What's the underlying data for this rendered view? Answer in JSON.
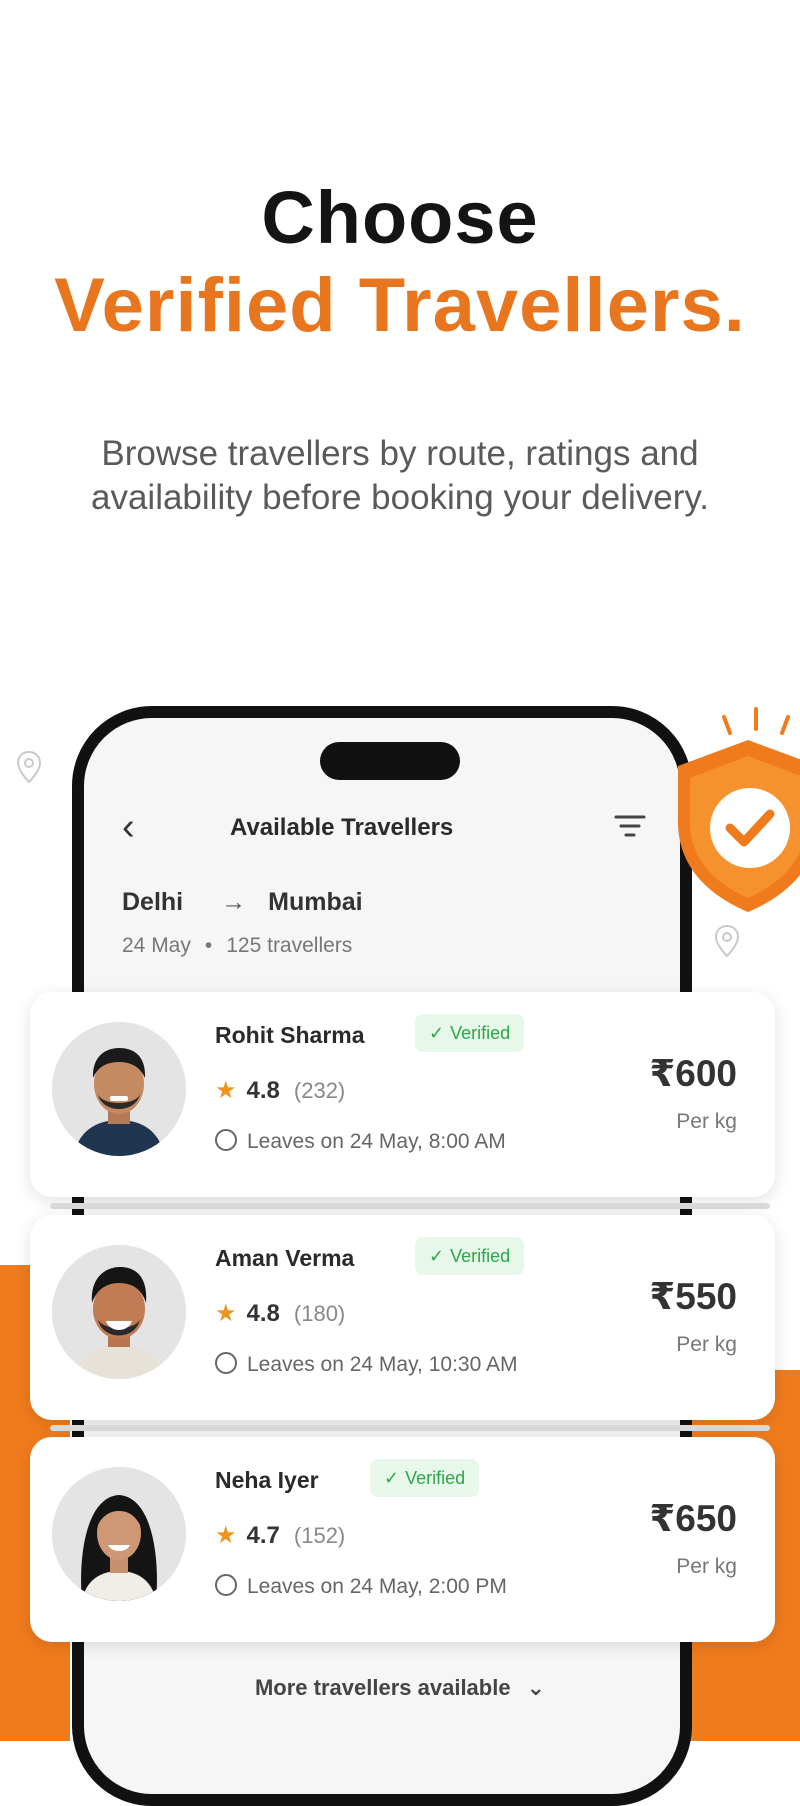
{
  "heading": {
    "line1": "Choose",
    "line2": "Verified Travellers."
  },
  "subtitle": "Browse travellers by route, ratings and availability before booking your delivery.",
  "colors": {
    "accent": "#e8761f",
    "verified_bg": "#e7f7e9",
    "verified_text": "#2ea64a",
    "star": "#f0931d"
  },
  "screen": {
    "title": "Available Travellers",
    "back_icon": "chevron-left-icon",
    "filter_icon": "filter-icon",
    "route": {
      "from": "Delhi",
      "arrow": "→",
      "to": "Mumbai"
    },
    "meta": {
      "date": "24 May",
      "separator": "•",
      "count": "125 travellers"
    }
  },
  "travellers": [
    {
      "name": "Rohit Sharma",
      "badge": "Verified",
      "rating": "4.8",
      "reviews": "(232)",
      "leaves": "Leaves on 24 May, 8:00 AM",
      "price": "₹600",
      "unit": "Per kg"
    },
    {
      "name": "Aman Verma",
      "badge": "Verified",
      "rating": "4.8",
      "reviews": "(180)",
      "leaves": "Leaves on 24 May, 10:30 AM",
      "price": "₹550",
      "unit": "Per kg"
    },
    {
      "name": "Neha Iyer",
      "badge": "Verified",
      "rating": "4.7",
      "reviews": "(152)",
      "leaves": "Leaves on 24 May, 2:00 PM",
      "price": "₹650",
      "unit": "Per kg"
    }
  ],
  "more_label": "More travellers available"
}
